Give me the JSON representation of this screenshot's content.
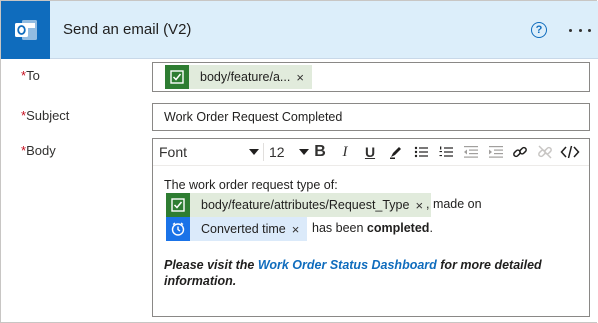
{
  "header": {
    "title": "Send an email (V2)"
  },
  "fields": {
    "to": {
      "required_mark": "*",
      "label": "To",
      "token": "body/feature/a...",
      "remove": "×"
    },
    "subject": {
      "required_mark": "*",
      "label": "Subject",
      "value": "Work Order Request Completed"
    },
    "body": {
      "required_mark": "*",
      "label": "Body"
    }
  },
  "toolbar": {
    "font_label": "Font",
    "size_label": "12",
    "bold": "B",
    "italic": "I",
    "underline": "U"
  },
  "body_content": {
    "line1": "The work order request type of:",
    "token1": "body/feature/attributes/Request_Type",
    "after_token1": ", made on",
    "token2": "Converted time",
    "after_token2": "has been ",
    "completed": "completed",
    "period": ".",
    "para_start": "Please visit the ",
    "para_link": "Work Order Status Dashboard",
    "para_end": " for more detailed",
    "para_line2": "information.",
    "remove": "×"
  },
  "colors": {
    "header_bg": "#dceefa",
    "accent": "#0f6cbd",
    "required": "#c50f1f",
    "token_green": "#2e7d32",
    "token_blue": "#1a73e8"
  }
}
